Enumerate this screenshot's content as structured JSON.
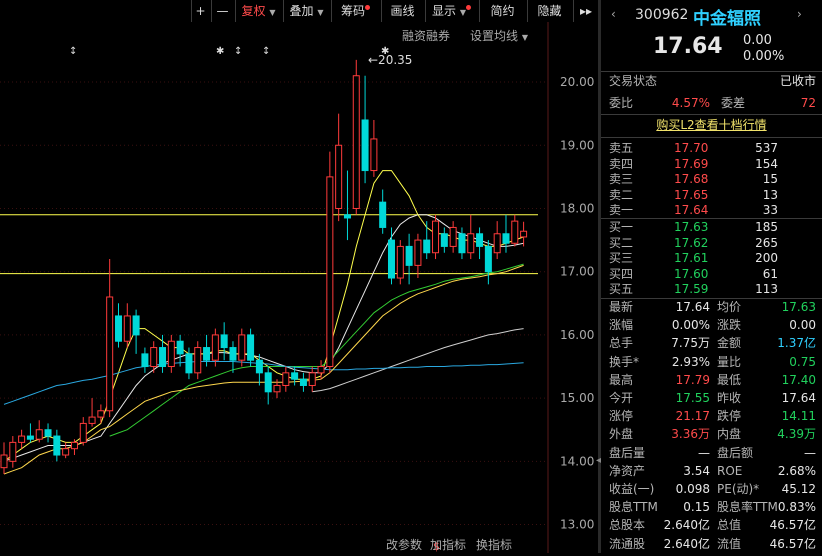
{
  "toolbar": {
    "plus": "+",
    "minus": "—",
    "adjust": "复权",
    "overlay": "叠加",
    "chips": "筹码",
    "draw": "画线",
    "display": "显示",
    "simple": "简约",
    "hide": "隐藏"
  },
  "chart_header": {
    "margin": "融资融券",
    "ma_setting": "设置均线"
  },
  "chart_data": {
    "type": "candlestick",
    "y_ticks": [
      "20.00",
      "19.00",
      "18.00",
      "17.00",
      "16.00",
      "15.00",
      "14.00",
      "13.00"
    ],
    "ylim": [
      12.55,
      20.95
    ],
    "high_annotation": "20.35",
    "hlines": [
      17.9,
      16.97
    ],
    "candles": [
      {
        "o": 13.9,
        "c": 14.1,
        "h": 14.3,
        "l": 13.8
      },
      {
        "o": 14.0,
        "c": 14.3,
        "h": 14.4,
        "l": 13.9
      },
      {
        "o": 14.3,
        "c": 14.4,
        "h": 14.5,
        "l": 14.2
      },
      {
        "o": 14.4,
        "c": 14.35,
        "h": 14.6,
        "l": 14.3
      },
      {
        "o": 14.35,
        "c": 14.5,
        "h": 14.65,
        "l": 14.3
      },
      {
        "o": 14.5,
        "c": 14.4,
        "h": 14.6,
        "l": 14.3
      },
      {
        "o": 14.4,
        "c": 14.1,
        "h": 14.5,
        "l": 14.0
      },
      {
        "o": 14.1,
        "c": 14.2,
        "h": 14.3,
        "l": 14.05
      },
      {
        "o": 14.2,
        "c": 14.3,
        "h": 14.35,
        "l": 14.1
      },
      {
        "o": 14.3,
        "c": 14.6,
        "h": 14.7,
        "l": 14.25
      },
      {
        "o": 14.6,
        "c": 14.7,
        "h": 15.0,
        "l": 14.55
      },
      {
        "o": 14.7,
        "c": 14.8,
        "h": 14.9,
        "l": 14.6
      },
      {
        "o": 14.8,
        "c": 16.6,
        "h": 17.2,
        "l": 14.7
      },
      {
        "o": 16.3,
        "c": 15.9,
        "h": 16.5,
        "l": 15.8
      },
      {
        "o": 15.9,
        "c": 16.3,
        "h": 16.5,
        "l": 15.8
      },
      {
        "o": 16.3,
        "c": 16.0,
        "h": 16.4,
        "l": 15.7
      },
      {
        "o": 15.7,
        "c": 15.5,
        "h": 15.8,
        "l": 15.4
      },
      {
        "o": 15.5,
        "c": 15.8,
        "h": 15.9,
        "l": 15.4
      },
      {
        "o": 15.8,
        "c": 15.5,
        "h": 16.0,
        "l": 15.4
      },
      {
        "o": 15.5,
        "c": 15.9,
        "h": 16.0,
        "l": 15.4
      },
      {
        "o": 15.9,
        "c": 15.7,
        "h": 16.0,
        "l": 15.5
      },
      {
        "o": 15.7,
        "c": 15.4,
        "h": 15.8,
        "l": 15.3
      },
      {
        "o": 15.4,
        "c": 15.8,
        "h": 15.9,
        "l": 15.3
      },
      {
        "o": 15.8,
        "c": 15.6,
        "h": 16.0,
        "l": 15.5
      },
      {
        "o": 15.6,
        "c": 16.0,
        "h": 16.1,
        "l": 15.5
      },
      {
        "o": 16.0,
        "c": 15.8,
        "h": 16.2,
        "l": 15.6
      },
      {
        "o": 15.8,
        "c": 15.6,
        "h": 15.9,
        "l": 15.4
      },
      {
        "o": 15.6,
        "c": 16.0,
        "h": 16.1,
        "l": 15.5
      },
      {
        "o": 16.0,
        "c": 15.6,
        "h": 16.1,
        "l": 15.5
      },
      {
        "o": 15.6,
        "c": 15.4,
        "h": 15.7,
        "l": 15.2
      },
      {
        "o": 15.4,
        "c": 15.1,
        "h": 15.5,
        "l": 14.9
      },
      {
        "o": 15.1,
        "c": 15.2,
        "h": 15.3,
        "l": 15.0
      },
      {
        "o": 15.2,
        "c": 15.4,
        "h": 15.5,
        "l": 15.1
      },
      {
        "o": 15.4,
        "c": 15.3,
        "h": 15.5,
        "l": 15.2
      },
      {
        "o": 15.3,
        "c": 15.2,
        "h": 15.4,
        "l": 15.1
      },
      {
        "o": 15.2,
        "c": 15.4,
        "h": 15.5,
        "l": 15.1
      },
      {
        "o": 15.4,
        "c": 15.5,
        "h": 15.6,
        "l": 15.3
      },
      {
        "o": 15.5,
        "c": 18.5,
        "h": 18.9,
        "l": 15.4
      },
      {
        "o": 18.0,
        "c": 19.0,
        "h": 19.5,
        "l": 17.8
      },
      {
        "o": 17.9,
        "c": 17.85,
        "h": 18.6,
        "l": 17.5
      },
      {
        "o": 18.0,
        "c": 20.1,
        "h": 20.35,
        "l": 17.9
      },
      {
        "o": 19.4,
        "c": 18.6,
        "h": 20.1,
        "l": 18.4
      },
      {
        "o": 18.6,
        "c": 19.1,
        "h": 19.4,
        "l": 18.5
      },
      {
        "o": 18.1,
        "c": 17.7,
        "h": 18.3,
        "l": 17.6
      },
      {
        "o": 17.5,
        "c": 16.9,
        "h": 17.7,
        "l": 16.8
      },
      {
        "o": 16.9,
        "c": 17.4,
        "h": 17.5,
        "l": 16.8
      },
      {
        "o": 17.4,
        "c": 17.1,
        "h": 17.6,
        "l": 16.8
      },
      {
        "o": 17.1,
        "c": 17.5,
        "h": 17.6,
        "l": 16.9
      },
      {
        "o": 17.5,
        "c": 17.3,
        "h": 17.8,
        "l": 17.2
      },
      {
        "o": 17.3,
        "c": 17.8,
        "h": 17.9,
        "l": 17.2
      },
      {
        "o": 17.6,
        "c": 17.4,
        "h": 17.7,
        "l": 17.3
      },
      {
        "o": 17.4,
        "c": 17.7,
        "h": 17.8,
        "l": 17.3
      },
      {
        "o": 17.6,
        "c": 17.3,
        "h": 17.7,
        "l": 17.2
      },
      {
        "o": 17.3,
        "c": 17.6,
        "h": 17.9,
        "l": 17.2
      },
      {
        "o": 17.6,
        "c": 17.4,
        "h": 17.7,
        "l": 17.2
      },
      {
        "o": 17.4,
        "c": 17.0,
        "h": 17.5,
        "l": 16.8
      },
      {
        "o": 17.3,
        "c": 17.6,
        "h": 17.8,
        "l": 17.2
      },
      {
        "o": 17.6,
        "c": 17.45,
        "h": 17.9,
        "l": 17.3
      },
      {
        "o": 17.45,
        "c": 17.8,
        "h": 17.9,
        "l": 17.4
      },
      {
        "o": 17.55,
        "c": 17.64,
        "h": 17.79,
        "l": 17.4
      }
    ],
    "ma_yellow": [
      14.0,
      14.1,
      14.2,
      14.3,
      14.35,
      14.4,
      14.35,
      14.3,
      14.3,
      14.4,
      14.5,
      14.6,
      15.0,
      15.4,
      15.8,
      16.1,
      16.1,
      16.0,
      15.9,
      15.8,
      15.8,
      15.7,
      15.7,
      15.7,
      15.75,
      15.75,
      15.7,
      15.7,
      15.7,
      15.6,
      15.5,
      15.4,
      15.35,
      15.3,
      15.3,
      15.3,
      15.35,
      15.8,
      16.3,
      16.8,
      17.4,
      17.9,
      18.4,
      18.6,
      18.6,
      18.4,
      18.2,
      17.9,
      17.7,
      17.6,
      17.6,
      17.55,
      17.5,
      17.5,
      17.45,
      17.4,
      17.4,
      17.45,
      17.5,
      17.55
    ],
    "ma_white": [
      14.0,
      14.05,
      14.1,
      14.15,
      14.2,
      14.25,
      14.25,
      14.25,
      14.25,
      14.3,
      14.35,
      14.4,
      14.6,
      14.8,
      15.0,
      15.2,
      15.35,
      15.45,
      15.55,
      15.6,
      15.65,
      15.7,
      15.7,
      15.7,
      15.72,
      15.72,
      15.7,
      15.7,
      15.68,
      15.65,
      15.6,
      15.55,
      15.5,
      15.45,
      15.42,
      15.4,
      15.4,
      15.55,
      15.8,
      16.1,
      16.4,
      16.7,
      17.0,
      17.3,
      17.55,
      17.75,
      17.85,
      17.9,
      17.9,
      17.85,
      17.75,
      17.65,
      17.6,
      17.55,
      17.5,
      17.45,
      17.4,
      17.4,
      17.42,
      17.45
    ],
    "ma_green": [
      null,
      null,
      null,
      null,
      null,
      null,
      null,
      null,
      null,
      null,
      null,
      null,
      14.4,
      14.45,
      14.5,
      14.6,
      14.7,
      14.8,
      14.9,
      15.0,
      15.1,
      15.2,
      15.25,
      15.3,
      15.35,
      15.4,
      15.45,
      15.48,
      15.5,
      15.5,
      15.5,
      15.5,
      15.5,
      15.5,
      15.5,
      15.5,
      15.5,
      15.6,
      15.75,
      15.9,
      16.05,
      16.2,
      16.35,
      16.45,
      16.55,
      16.62,
      16.68,
      16.72,
      16.76,
      16.8,
      16.85,
      16.88,
      16.9,
      16.92,
      16.95,
      16.98,
      17.0,
      17.04,
      17.08,
      17.12
    ],
    "ma_white_long": [
      null,
      null,
      null,
      null,
      null,
      null,
      null,
      null,
      null,
      null,
      null,
      null,
      null,
      null,
      null,
      null,
      null,
      null,
      null,
      null,
      null,
      null,
      null,
      null,
      null,
      null,
      null,
      null,
      null,
      null,
      null,
      null,
      null,
      null,
      null,
      15.1,
      15.12,
      15.15,
      15.2,
      15.25,
      15.3,
      15.35,
      15.4,
      15.45,
      15.5,
      15.55,
      15.6,
      15.65,
      15.7,
      15.75,
      15.8,
      15.84,
      15.88,
      15.92,
      15.96,
      16.0,
      16.02,
      16.05,
      16.08,
      16.1
    ],
    "ma_blue": [
      14.9,
      14.95,
      15.0,
      15.05,
      15.1,
      15.15,
      15.2,
      15.22,
      15.25,
      15.28,
      15.3,
      15.33,
      15.36,
      15.4,
      15.44,
      15.48,
      15.5,
      15.52,
      15.54,
      15.55,
      15.56,
      15.57,
      15.58,
      15.58,
      15.58,
      15.58,
      15.58,
      15.57,
      15.56,
      15.55,
      15.54,
      15.52,
      15.5,
      15.49,
      15.48,
      15.47,
      15.46,
      15.45,
      15.45,
      15.45,
      15.46,
      15.46,
      15.47,
      15.47,
      15.48,
      15.48,
      15.49,
      15.49,
      15.5,
      15.5,
      15.5,
      15.51,
      15.51,
      15.52,
      15.52,
      15.53,
      15.53,
      15.54,
      15.55,
      15.56
    ],
    "ma_yellow_short": [
      13.8,
      13.85,
      13.9,
      14.0,
      14.1,
      14.15,
      14.2,
      14.2,
      14.25,
      14.3,
      14.4,
      14.5,
      14.55,
      14.65,
      14.75,
      14.85,
      14.95,
      15.0,
      15.05,
      15.1,
      15.12,
      15.15,
      15.18,
      15.2,
      15.22,
      15.24,
      15.25,
      15.25,
      15.25,
      15.25,
      15.25,
      15.25,
      15.25,
      15.26,
      15.27,
      15.28,
      15.3,
      15.4,
      15.55,
      15.7,
      15.85,
      16.0,
      16.15,
      16.3,
      16.4,
      16.5,
      16.58,
      16.65,
      16.7,
      16.75,
      16.8,
      16.85,
      16.88,
      16.9,
      16.92,
      16.95,
      16.97,
      17.0,
      17.05,
      17.1
    ]
  },
  "bottom_bar": {
    "param": "改参数",
    "add_indicator": "加指标",
    "change_indicator": "换指标"
  },
  "quote": {
    "code": "300962",
    "name": "中金辐照",
    "price": "17.64",
    "change": "0.00",
    "change_pct": "0.00%",
    "status_label": "交易状态",
    "status_value": "已收市",
    "ratio_label": "委比",
    "ratio_value": "4.57%",
    "diff_label": "委差",
    "diff_value": "72",
    "l2_link": "购买L2查看十档行情",
    "asks": [
      {
        "label": "卖五",
        "price": "17.70",
        "vol": "537"
      },
      {
        "label": "卖四",
        "price": "17.69",
        "vol": "154"
      },
      {
        "label": "卖三",
        "price": "17.68",
        "vol": "15"
      },
      {
        "label": "卖二",
        "price": "17.65",
        "vol": "13"
      },
      {
        "label": "卖一",
        "price": "17.64",
        "vol": "33"
      }
    ],
    "bids": [
      {
        "label": "买一",
        "price": "17.63",
        "vol": "185"
      },
      {
        "label": "买二",
        "price": "17.62",
        "vol": "265"
      },
      {
        "label": "买三",
        "price": "17.61",
        "vol": "200"
      },
      {
        "label": "买四",
        "price": "17.60",
        "vol": "61"
      },
      {
        "label": "买五",
        "price": "17.59",
        "vol": "113"
      }
    ],
    "stats": [
      {
        "l1": "最新",
        "v1": "17.64",
        "c1": "wht",
        "l2": "均价",
        "v2": "17.63",
        "c2": "grn"
      },
      {
        "l1": "涨幅",
        "v1": "0.00%",
        "c1": "wht",
        "l2": "涨跌",
        "v2": "0.00",
        "c2": "wht"
      },
      {
        "l1": "总手",
        "v1": "7.75万",
        "c1": "wht",
        "l2": "金额",
        "v2": "1.37亿",
        "c2": "cyan"
      },
      {
        "l1": "换手*",
        "v1": "2.93%",
        "c1": "wht",
        "l2": "量比",
        "v2": "0.75",
        "c2": "grn"
      },
      {
        "l1": "最高",
        "v1": "17.79",
        "c1": "red",
        "l2": "最低",
        "v2": "17.40",
        "c2": "grn"
      },
      {
        "l1": "今开",
        "v1": "17.55",
        "c1": "grn",
        "l2": "昨收",
        "v2": "17.64",
        "c2": "wht"
      },
      {
        "l1": "涨停",
        "v1": "21.17",
        "c1": "red",
        "l2": "跌停",
        "v2": "14.11",
        "c2": "grn"
      },
      {
        "l1": "外盘",
        "v1": "3.36万",
        "c1": "red",
        "l2": "内盘",
        "v2": "4.39万",
        "c2": "grn"
      },
      {
        "l1": "盘后量",
        "v1": "—",
        "c1": "wht",
        "l2": "盘后额",
        "v2": "—",
        "c2": "wht"
      },
      {
        "l1": "净资产",
        "v1": "3.54",
        "c1": "wht",
        "l2": "ROE",
        "v2": "2.68%",
        "c2": "wht"
      },
      {
        "l1": "收益(一)",
        "v1": "0.098",
        "c1": "wht",
        "l2": "PE(动)*",
        "v2": "45.12",
        "c2": "wht"
      },
      {
        "l1": "股息TTM",
        "v1": "0.15",
        "c1": "wht",
        "l2": "股息率TTM",
        "v2": "0.83%",
        "c2": "wht"
      },
      {
        "l1": "总股本",
        "v1": "2.640亿",
        "c1": "wht",
        "l2": "总值",
        "v2": "46.57亿",
        "c2": "wht"
      },
      {
        "l1": "流通股",
        "v1": "2.640亿",
        "c1": "wht",
        "l2": "流值",
        "v2": "46.57亿",
        "c2": "wht"
      }
    ]
  },
  "colors": {
    "up": "#ff3b3b",
    "down": "#00d8d8",
    "ma5": "#ffffff",
    "ma10": "#ffff4d",
    "ma20": "#33cc33",
    "ma60": "#2aa8e0",
    "hline": "#ffff4d",
    "grid": "#3a1010"
  }
}
